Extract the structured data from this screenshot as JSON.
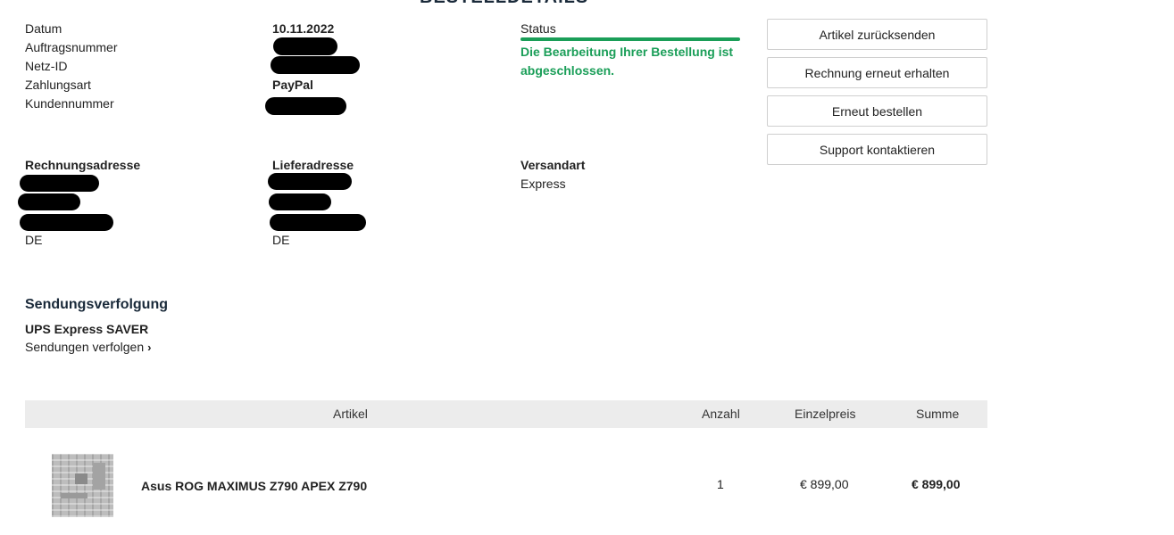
{
  "page": {
    "heading": "BESTELLDETAILS"
  },
  "order": {
    "date_label": "Datum",
    "date_value": "10.11.2022",
    "order_number_label": "Auftragsnummer",
    "net_id_label": "Netz-ID",
    "payment_label": "Zahlungsart",
    "payment_value": "PayPal",
    "customer_number_label": "Kundennummer"
  },
  "status": {
    "label": "Status",
    "text": "Die Bearbeitung Ihrer Bestellung ist abgeschlossen.",
    "color": "#1a9e58"
  },
  "actions": {
    "return_items": "Artikel zurücksenden",
    "resend_invoice": "Rechnung erneut erhalten",
    "reorder": "Erneut bestellen",
    "contact_support": "Support kontaktieren"
  },
  "billing": {
    "label": "Rechnungsadresse",
    "country": "DE"
  },
  "shipping": {
    "label": "Lieferadresse",
    "country": "DE"
  },
  "shipping_method": {
    "label": "Versandart",
    "value": "Express"
  },
  "tracking": {
    "title": "Sendungsverfolgung",
    "carrier": "UPS Express SAVER",
    "link_label": "Sendungen verfolgen",
    "link_icon": "chevron-right-icon"
  },
  "table": {
    "headers": {
      "item": "Artikel",
      "quantity": "Anzahl",
      "unit_price": "Einzelpreis",
      "total": "Summe"
    },
    "rows": [
      {
        "name": "Asus ROG MAXIMUS Z790 APEX Z790",
        "quantity": "1",
        "unit_price": "€ 899,00",
        "total": "€ 899,00"
      }
    ]
  }
}
